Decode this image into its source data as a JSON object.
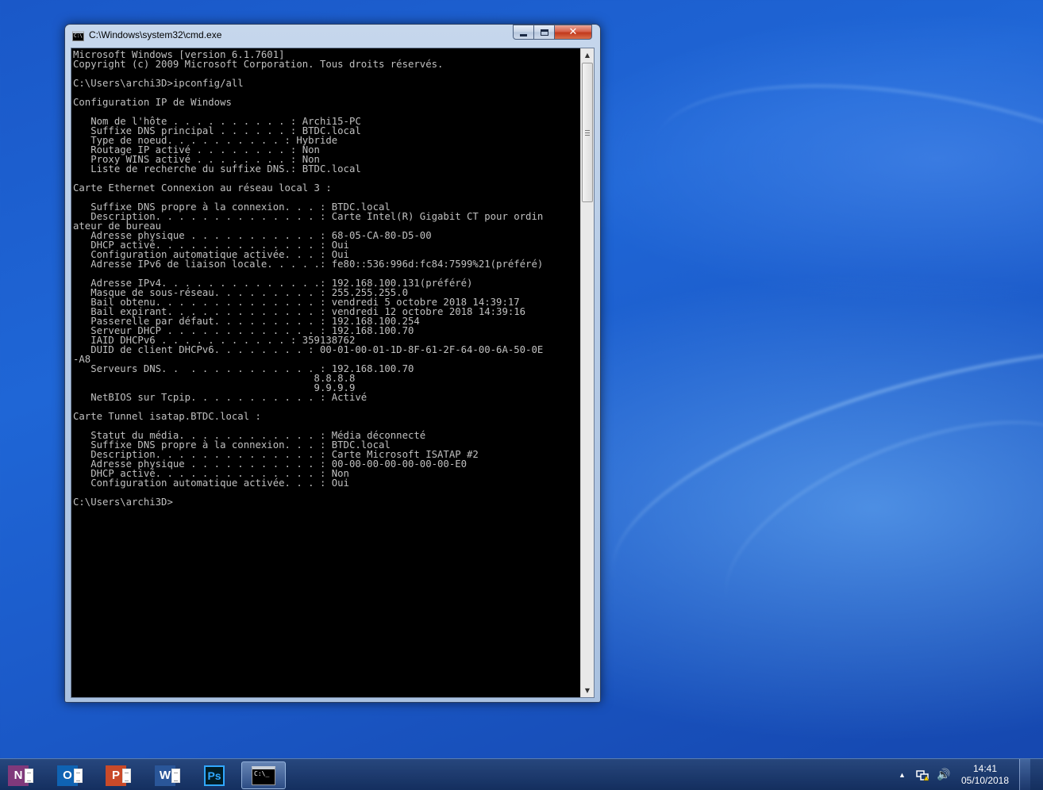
{
  "window": {
    "title": "C:\\Windows\\system32\\cmd.exe",
    "close_glyph": "✕",
    "console_lines": [
      "Microsoft Windows [version 6.1.7601]",
      "Copyright (c) 2009 Microsoft Corporation. Tous droits réservés.",
      "",
      "C:\\Users\\archi3D>ipconfig/all",
      "",
      "Configuration IP de Windows",
      "",
      "   Nom de l'hôte . . . . . . . . . . : Archi15-PC",
      "   Suffixe DNS principal . . . . . . : BTDC.local",
      "   Type de noeud. . . . . . . . . . : Hybride",
      "   Routage IP activé . . . . . . . . : Non",
      "   Proxy WINS activé . . . . . . . . : Non",
      "   Liste de recherche du suffixe DNS.: BTDC.local",
      "",
      "Carte Ethernet Connexion au réseau local 3 :",
      "",
      "   Suffixe DNS propre à la connexion. . . : BTDC.local",
      "   Description. . . . . . . . . . . . . . : Carte Intel(R) Gigabit CT pour ordin",
      "ateur de bureau",
      "   Adresse physique . . . . . . . . . . . : 68-05-CA-80-D5-00",
      "   DHCP activé. . . . . . . . . . . . . . : Oui",
      "   Configuration automatique activée. . . : Oui",
      "   Adresse IPv6 de liaison locale. . . . .: fe80::536:996d:fc84:7599%21(préféré)",
      "",
      "   Adresse IPv4. . . . . . . . . . . . . .: 192.168.100.131(préféré)",
      "   Masque de sous-réseau. . . . . . . . . : 255.255.255.0",
      "   Bail obtenu. . . . . . . . . . . . . . : vendredi 5 octobre 2018 14:39:17",
      "   Bail expirant. . . . . . . . . . . . . : vendredi 12 octobre 2018 14:39:16",
      "   Passerelle par défaut. . . . . . . . . : 192.168.100.254",
      "   Serveur DHCP . . . . . . . . . . . . . : 192.168.100.70",
      "   IAID DHCPv6 . . . . . . . . . . . : 359138762",
      "   DUID de client DHCPv6. . . . . . . . : 00-01-00-01-1D-8F-61-2F-64-00-6A-50-0E",
      "-A8",
      "   Serveurs DNS. .  . . . . . . . . . . . : 192.168.100.70",
      "                                         8.8.8.8",
      "                                         9.9.9.9",
      "   NetBIOS sur Tcpip. . . . . . . . . . . : Activé",
      "",
      "Carte Tunnel isatap.BTDC.local :",
      "",
      "   Statut du média. . . . . . . . . . . . : Média déconnecté",
      "   Suffixe DNS propre à la connexion. . . : BTDC.local",
      "   Description. . . . . . . . . . . . . . : Carte Microsoft ISATAP #2",
      "   Adresse physique . . . . . . . . . . . : 00-00-00-00-00-00-00-E0",
      "   DHCP activé. . . . . . . . . . . . . . : Non",
      "   Configuration automatique activée. . . : Oui",
      "",
      "C:\\Users\\archi3D>"
    ]
  },
  "taskbar": {
    "apps": [
      {
        "name": "onenote",
        "glyph": "N"
      },
      {
        "name": "outlook",
        "glyph": "O"
      },
      {
        "name": "powerpoint",
        "glyph": "P"
      },
      {
        "name": "word",
        "glyph": "W"
      },
      {
        "name": "photoshop",
        "glyph": "Ps"
      },
      {
        "name": "cmd",
        "glyph": "C:\\_"
      }
    ],
    "tray": {
      "show_hidden_glyph": "▲",
      "volume_glyph": "🔊",
      "time": "14:41",
      "date": "05/10/2018"
    }
  },
  "colors": {
    "console_bg": "#000000",
    "console_fg": "#c0c0c0",
    "desktop": "#1f66d6"
  }
}
